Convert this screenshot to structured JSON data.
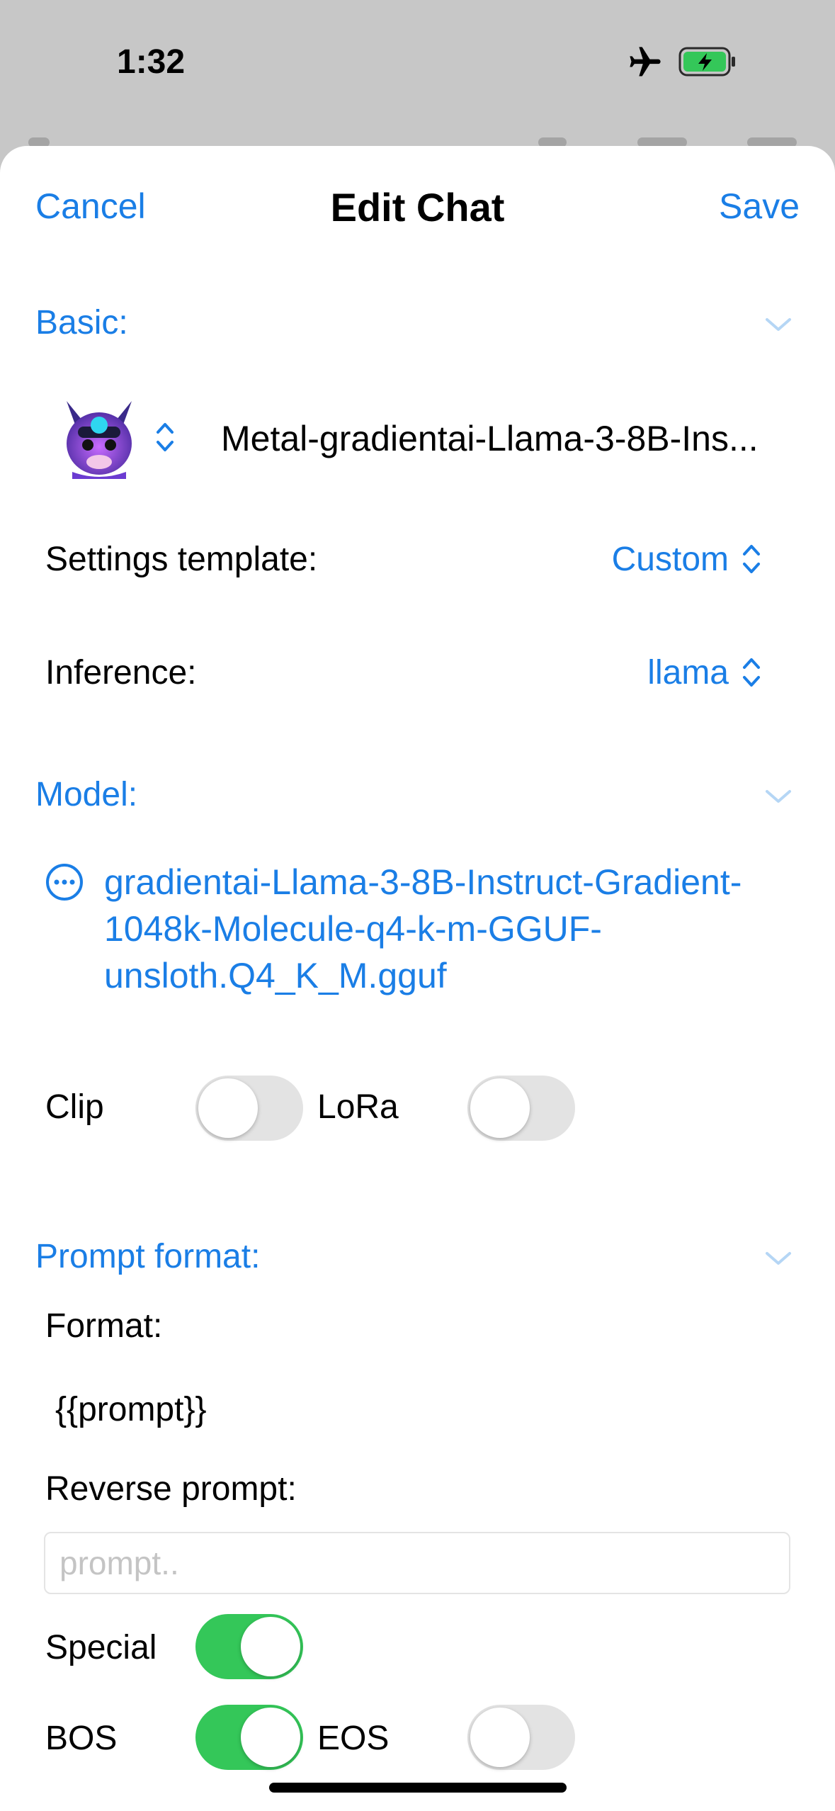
{
  "status": {
    "time": "1:32"
  },
  "nav": {
    "cancel": "Cancel",
    "title": "Edit Chat",
    "save": "Save"
  },
  "basic": {
    "title": "Basic:",
    "model_name": "Metal-gradientai-Llama-3-8B-Ins...",
    "settings_template_label": "Settings template:",
    "settings_template_value": "Custom",
    "inference_label": "Inference:",
    "inference_value": "llama"
  },
  "model": {
    "title": "Model:",
    "file": "gradientai-Llama-3-8B-Instruct-Gradient-1048k-Molecule-q4-k-m-GGUF-unsloth.Q4_K_M.gguf",
    "clip_label": "Clip",
    "clip_on": false,
    "lora_label": "LoRa",
    "lora_on": false
  },
  "prompt_format": {
    "title": "Prompt format:",
    "format_label": "Format:",
    "format_value": "{{prompt}}",
    "reverse_prompt_label": "Reverse prompt:",
    "reverse_prompt_placeholder": "prompt..",
    "reverse_prompt_value": "",
    "special_label": "Special",
    "special_on": true,
    "bos_label": "BOS",
    "bos_on": true,
    "eos_label": "EOS",
    "eos_on": false
  },
  "colors": {
    "accent": "#1a7ee6",
    "toggle_on": "#34c759",
    "toggle_off": "#e3e3e3"
  }
}
